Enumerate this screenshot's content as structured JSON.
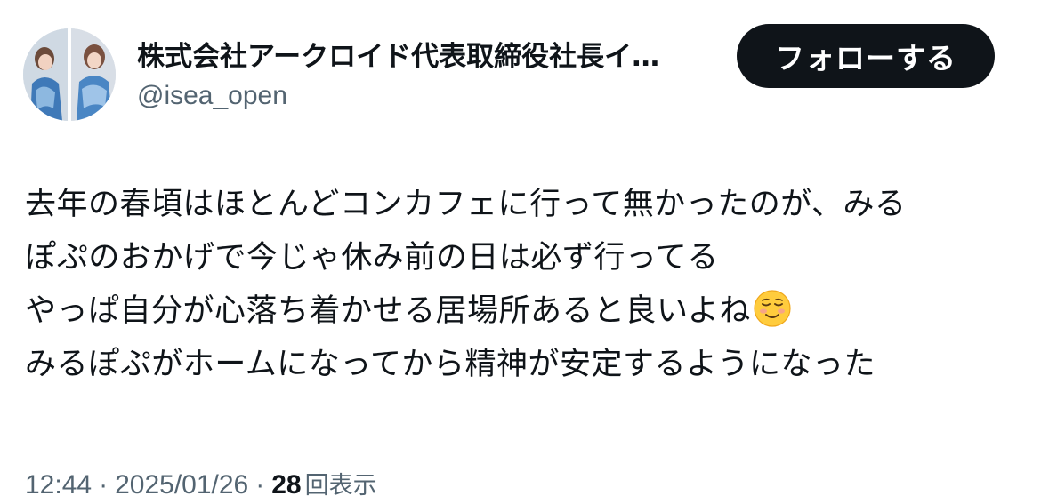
{
  "author": {
    "display_name": "株式会社アークロイド代表取締役社長イ…",
    "handle": "@isea_open"
  },
  "follow_button": {
    "label": "フォローする"
  },
  "tweet": {
    "lines": [
      "去年の春頃はほとんどコンカフェに行って無かったのが、みる",
      "ぽぷのおかげで今じゃ休み前の日は必ず行ってる",
      "やっぱ自分が心落ち着かせる居場所あると良いよね",
      "みるぽぷがホームになってから精神が安定するようになった"
    ],
    "emoji": "relieved-smile-emoji"
  },
  "meta": {
    "time": "12:44",
    "separator": "·",
    "date": "2025/01/26",
    "views_count": "28",
    "views_label": "回表示"
  },
  "colors": {
    "text_primary": "#0f1419",
    "text_secondary": "#536471",
    "button_bg": "#0f1419",
    "button_text": "#ffffff"
  }
}
